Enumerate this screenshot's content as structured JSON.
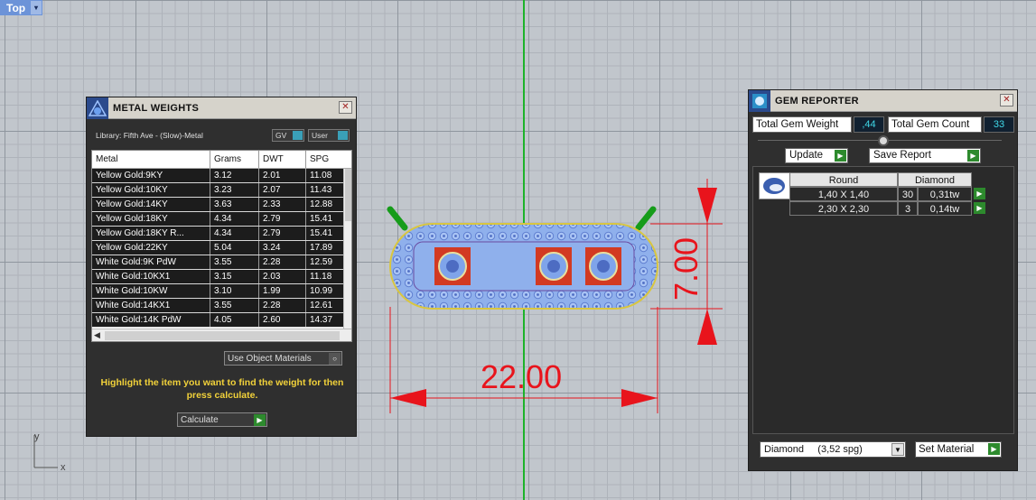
{
  "viewport": {
    "label": "Top",
    "dropdown_glyph": "▾",
    "axis_labels": {
      "x": "x",
      "y": "y"
    },
    "dimensions": {
      "width": "22.00",
      "height": "7.00"
    }
  },
  "metal_weights": {
    "title": "METAL WEIGHTS",
    "library_label": "Library: Fifth Ave - (Slow)-Metal",
    "gv_label": "GV",
    "user_label": "User",
    "columns": [
      "Metal",
      "Grams",
      "DWT",
      "SPG"
    ],
    "rows": [
      [
        "Yellow Gold:9KY",
        "3.12",
        "2.01",
        "11.08"
      ],
      [
        "Yellow Gold:10KY",
        "3.23",
        "2.07",
        "11.43"
      ],
      [
        "Yellow Gold:14KY",
        "3.63",
        "2.33",
        "12.88"
      ],
      [
        "Yellow Gold:18KY",
        "4.34",
        "2.79",
        "15.41"
      ],
      [
        "Yellow Gold:18KY R...",
        "4.34",
        "2.79",
        "15.41"
      ],
      [
        "Yellow Gold:22KY",
        "5.04",
        "3.24",
        "17.89"
      ],
      [
        "White Gold:9K PdW",
        "3.55",
        "2.28",
        "12.59"
      ],
      [
        "White Gold:10KX1",
        "3.15",
        "2.03",
        "11.18"
      ],
      [
        "White Gold:10KW",
        "3.10",
        "1.99",
        "10.99"
      ],
      [
        "White Gold:14KX1",
        "3.55",
        "2.28",
        "12.61"
      ],
      [
        "White Gold:14K PdW",
        "4.05",
        "2.60",
        "14.37"
      ]
    ],
    "use_object_materials": "Use Object Materials",
    "hint": "Highlight the item you want to find the weight for then press calculate.",
    "calculate_label": "Calculate",
    "close_glyph": "✕"
  },
  "gem_reporter": {
    "title": "GEM REPORTER",
    "total_gem_weight_label": "Total Gem Weight",
    "total_gem_weight_value": ",44",
    "total_gem_count_label": "Total Gem Count",
    "total_gem_count_value": "33",
    "update_label": "Update",
    "save_report_label": "Save Report",
    "columns": [
      "Round",
      "Diamond"
    ],
    "rows": [
      [
        "1,40 X 1,40",
        "30",
        "0,31tw"
      ],
      [
        "2,30 X 2,30",
        "3",
        "0,14tw"
      ]
    ],
    "material_select": "Diamond     (3,52 spg)",
    "set_material_label": "Set Material",
    "close_glyph": "✕"
  },
  "colors": {
    "grid_bg": "#c1c6cc",
    "y_axis": "#1db32a",
    "dimension": "#e8141c",
    "accent_blue": "#6c93d8",
    "hint_yellow": "#f2d23a",
    "value_cyan": "#3fd8e8"
  }
}
